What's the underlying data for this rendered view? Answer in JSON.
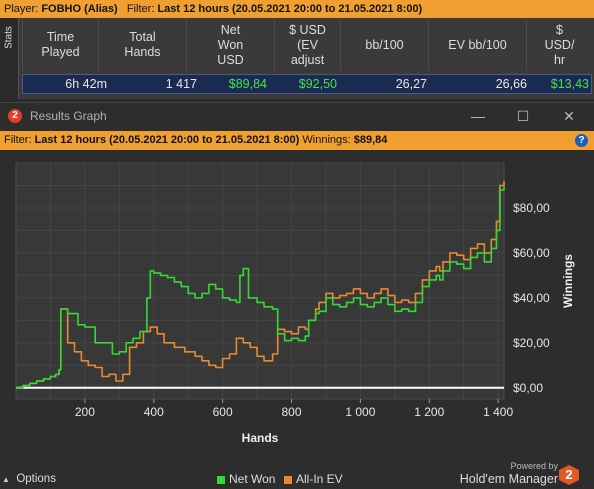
{
  "topbar": {
    "player_label": "Player:",
    "player_name": "FOBHO (Alias)",
    "filter_label": "Filter:",
    "filter_value": "Last 12 hours (20.05.2021 20:00 to 21.05.2021 8:00)"
  },
  "stats": {
    "tab_label": "Stats",
    "columns": [
      {
        "l1": "Time",
        "l2": "Played",
        "l3": ""
      },
      {
        "l1": "Total",
        "l2": "Hands",
        "l3": ""
      },
      {
        "l1": "Net",
        "l2": "Won",
        "l3": "USD"
      },
      {
        "l1": "$ USD",
        "l2": "(EV",
        "l3": "adjust"
      },
      {
        "l1": "bb/100",
        "l2": "",
        "l3": ""
      },
      {
        "l1": "EV bb/100",
        "l2": "",
        "l3": ""
      },
      {
        "l1": "$",
        "l2": "USD/",
        "l3": "hr"
      }
    ],
    "row": [
      "6h 42m",
      "1 417",
      "$89,84",
      "$92,50",
      "26,27",
      "26,66",
      "$13,43"
    ]
  },
  "window": {
    "badge": "2",
    "title": "Results Graph",
    "minimize_glyph": "—",
    "maximize_glyph": "☐",
    "close_glyph": "✕"
  },
  "filterbar": {
    "filter_label": "Filter:",
    "filter_value": "Last 12 hours (20.05.2021 20:00 to 21.05.2021 8:00)",
    "winnings_label": "Winnings:",
    "winnings_value": "$89,84",
    "help_glyph": "?"
  },
  "chart_data": {
    "type": "line",
    "xlabel": "Hands",
    "ylabel": "Winnings",
    "xlim": [
      0,
      1417
    ],
    "ylim": [
      -5,
      100
    ],
    "x_ticks": [
      200,
      400,
      600,
      800,
      1000,
      1200,
      1400
    ],
    "x_tick_labels": [
      "200",
      "400",
      "600",
      "800",
      "1 000",
      "1 200",
      "1 400"
    ],
    "y_ticks": [
      0,
      20,
      40,
      60,
      80
    ],
    "y_tick_labels": [
      "$0,00",
      "$20,00",
      "$40,00",
      "$60,00",
      "$80,00"
    ],
    "grid": true,
    "legend_position": "bottom",
    "series": [
      {
        "name": "Net Won",
        "color": "#35d835",
        "points": [
          [
            0,
            0
          ],
          [
            20,
            1
          ],
          [
            40,
            2
          ],
          [
            60,
            3
          ],
          [
            80,
            4
          ],
          [
            100,
            5
          ],
          [
            115,
            6
          ],
          [
            125,
            8
          ],
          [
            130,
            35
          ],
          [
            150,
            33
          ],
          [
            180,
            28
          ],
          [
            200,
            27
          ],
          [
            230,
            20
          ],
          [
            250,
            20
          ],
          [
            280,
            15
          ],
          [
            300,
            16
          ],
          [
            320,
            20
          ],
          [
            340,
            22
          ],
          [
            360,
            25
          ],
          [
            380,
            40
          ],
          [
            390,
            52
          ],
          [
            400,
            51
          ],
          [
            420,
            50
          ],
          [
            440,
            49
          ],
          [
            460,
            47
          ],
          [
            480,
            45
          ],
          [
            500,
            42
          ],
          [
            520,
            40
          ],
          [
            540,
            42
          ],
          [
            560,
            46
          ],
          [
            580,
            44
          ],
          [
            600,
            40
          ],
          [
            620,
            39
          ],
          [
            640,
            38
          ],
          [
            650,
            50
          ],
          [
            660,
            53
          ],
          [
            675,
            40
          ],
          [
            700,
            38
          ],
          [
            720,
            36
          ],
          [
            745,
            35
          ],
          [
            760,
            24
          ],
          [
            780,
            21
          ],
          [
            800,
            22
          ],
          [
            820,
            21
          ],
          [
            840,
            23
          ],
          [
            850,
            30
          ],
          [
            870,
            33
          ],
          [
            880,
            34
          ],
          [
            900,
            40
          ],
          [
            920,
            37
          ],
          [
            940,
            36
          ],
          [
            960,
            38
          ],
          [
            980,
            40
          ],
          [
            1000,
            37
          ],
          [
            1020,
            36
          ],
          [
            1040,
            38
          ],
          [
            1060,
            40
          ],
          [
            1080,
            37
          ],
          [
            1100,
            34
          ],
          [
            1120,
            35
          ],
          [
            1140,
            34
          ],
          [
            1160,
            38
          ],
          [
            1180,
            45
          ],
          [
            1200,
            48
          ],
          [
            1220,
            50
          ],
          [
            1230,
            48
          ],
          [
            1240,
            52
          ],
          [
            1260,
            56
          ],
          [
            1280,
            55
          ],
          [
            1300,
            53
          ],
          [
            1320,
            58
          ],
          [
            1340,
            60
          ],
          [
            1360,
            56
          ],
          [
            1380,
            62
          ],
          [
            1395,
            70
          ],
          [
            1405,
            88
          ],
          [
            1417,
            90
          ]
        ]
      },
      {
        "name": "All-In EV",
        "color": "#e88a30",
        "points": [
          [
            0,
            0
          ],
          [
            20,
            1
          ],
          [
            40,
            2
          ],
          [
            60,
            3
          ],
          [
            80,
            4
          ],
          [
            100,
            5
          ],
          [
            115,
            6
          ],
          [
            125,
            8
          ],
          [
            130,
            35
          ],
          [
            150,
            20
          ],
          [
            170,
            16
          ],
          [
            190,
            12
          ],
          [
            210,
            10
          ],
          [
            230,
            9
          ],
          [
            250,
            5
          ],
          [
            270,
            6
          ],
          [
            290,
            3
          ],
          [
            310,
            6
          ],
          [
            330,
            18
          ],
          [
            350,
            20
          ],
          [
            370,
            25
          ],
          [
            390,
            27
          ],
          [
            410,
            24
          ],
          [
            430,
            20
          ],
          [
            460,
            18
          ],
          [
            490,
            16
          ],
          [
            520,
            14
          ],
          [
            540,
            12
          ],
          [
            560,
            10
          ],
          [
            580,
            9
          ],
          [
            600,
            13
          ],
          [
            620,
            15
          ],
          [
            640,
            22
          ],
          [
            660,
            20
          ],
          [
            680,
            18
          ],
          [
            700,
            14
          ],
          [
            720,
            12
          ],
          [
            745,
            15
          ],
          [
            760,
            26
          ],
          [
            780,
            25
          ],
          [
            800,
            24
          ],
          [
            820,
            27
          ],
          [
            840,
            26
          ],
          [
            850,
            30
          ],
          [
            870,
            35
          ],
          [
            880,
            38
          ],
          [
            900,
            42
          ],
          [
            920,
            40
          ],
          [
            940,
            41
          ],
          [
            960,
            42
          ],
          [
            980,
            44
          ],
          [
            1000,
            42
          ],
          [
            1020,
            40
          ],
          [
            1040,
            42
          ],
          [
            1060,
            44
          ],
          [
            1080,
            41
          ],
          [
            1100,
            38
          ],
          [
            1120,
            39
          ],
          [
            1140,
            38
          ],
          [
            1160,
            42
          ],
          [
            1180,
            48
          ],
          [
            1200,
            52
          ],
          [
            1220,
            54
          ],
          [
            1230,
            52
          ],
          [
            1240,
            56
          ],
          [
            1260,
            60
          ],
          [
            1280,
            59
          ],
          [
            1300,
            57
          ],
          [
            1320,
            62
          ],
          [
            1340,
            64
          ],
          [
            1360,
            60
          ],
          [
            1380,
            66
          ],
          [
            1395,
            74
          ],
          [
            1405,
            90
          ],
          [
            1417,
            92
          ]
        ]
      }
    ]
  },
  "footer": {
    "options_label": "Options",
    "powered_by": "Powered by",
    "product": "Hold'em Manager",
    "logo_digit": "2"
  }
}
